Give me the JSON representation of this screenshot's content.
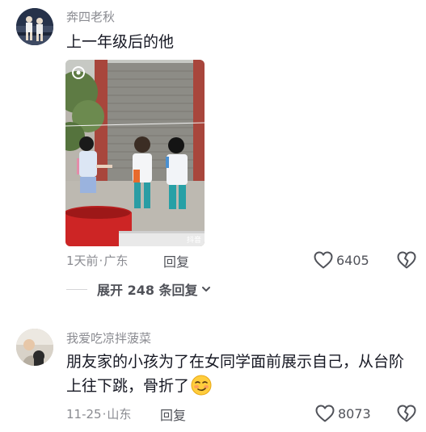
{
  "comments": [
    {
      "username": "奔四老秋",
      "text": "上一年级后的他",
      "video_watermark": "抖音",
      "date": "1天前",
      "location": "广东",
      "reply_label": "回复",
      "like_count": "6405",
      "expand_replies_label": "展开 248 条回复"
    },
    {
      "username": "我爱吃凉拌菠菜",
      "text": "朋友家的小孩为了在女同学面前展示自己，从台阶上往下跳，骨折了",
      "date": "11-25",
      "location": "山东",
      "reply_label": "回复",
      "like_count": "8073"
    }
  ],
  "separator": "·",
  "icons": {
    "like": "heart-outline-icon",
    "dislike": "broken-heart-icon",
    "expand": "chevron-down-icon",
    "emoji": "smirk-emoji-icon"
  },
  "colors": {
    "primary_text": "#161823",
    "secondary_text": "#8a8b91",
    "action_text": "#505259",
    "icon_stroke": "#505259"
  }
}
